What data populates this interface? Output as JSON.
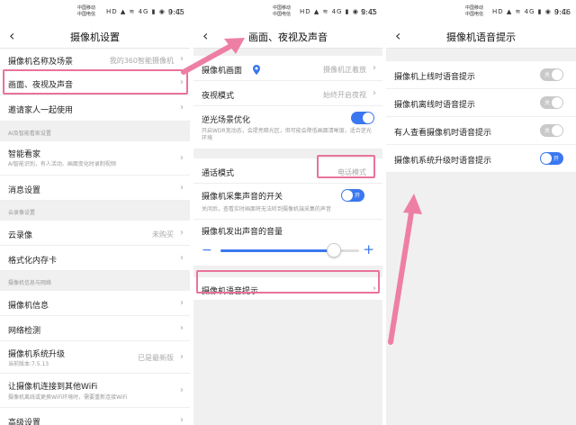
{
  "status_bar": {
    "carrier1": "中国移动",
    "carrier2": "中国电信",
    "icons": "HD ▲ ≋ 4G ▮ ◉ ▯ ▢",
    "time1": "9:45",
    "time2": "9:45",
    "time3": "9:46"
  },
  "panel1": {
    "title": "摄像机设置",
    "rows": {
      "name_location": "摄像机名称及场景",
      "name_value": "我的360智能摄像机",
      "picture_night_sound": "画面、夜视及声音",
      "invite": "邀请家人一起使用"
    },
    "section_ai": "AI及智能看家设置",
    "smart_watch": "智能看家",
    "smart_watch_sub": "AI智能识别，有人活动、画面变化时录制视频",
    "message_settings": "消息设置",
    "section_cloud": "云录像设置",
    "cloud_record": "云录像",
    "cloud_value": "未购买",
    "format_card": "格式化内存卡",
    "section_info": "摄像机信息与网络",
    "camera_info": "摄像机信息",
    "network_test": "网络检测",
    "upgrade": "摄像机系统升级",
    "upgrade_sub": "当前版本:7.5.13",
    "upgrade_value": "已是最新版",
    "wifi": "让摄像机连接到其他WiFi",
    "wifi_sub": "摄像机离线或更换WiFi环境时，需要重新连接WiFi",
    "advanced": "高级设置"
  },
  "panel2": {
    "title": "画面、夜视及声音",
    "camera_picture": "摄像机画面",
    "camera_picture_value": "摄像机正着放",
    "night_mode": "夜视模式",
    "night_mode_value": "始终开启夜视",
    "backlight": "逆光场景优化",
    "backlight_sub": "开启WDR宽动态，会提亮暗光区，但可能会降低画面清晰度，适合逆光环境",
    "call_mode": "通话模式",
    "call_mode_value": "电话模式",
    "mic_switch": "摄像机采集声音的开关",
    "mic_sub": "关闭后，查看实时画面将无法听到摄像机端采集的声音",
    "mic_toggle_label": "开",
    "volume_label": "摄像机发出声音的音量",
    "volume_level": 0.82,
    "voice_prompt": "摄像机语音提示"
  },
  "panel3": {
    "title": "摄像机语音提示",
    "items": [
      {
        "label": "摄像机上线时语音提示",
        "state": "关"
      },
      {
        "label": "摄像机离线时语音提示",
        "state": "关"
      },
      {
        "label": "有人查看摄像机时语音提示",
        "state": "关"
      },
      {
        "label": "摄像机系统升级时语音提示",
        "state": "开"
      }
    ]
  },
  "colors": {
    "accent": "#3a77f0",
    "highlight": "#e9739a",
    "arrow": "#ee7fa4"
  }
}
